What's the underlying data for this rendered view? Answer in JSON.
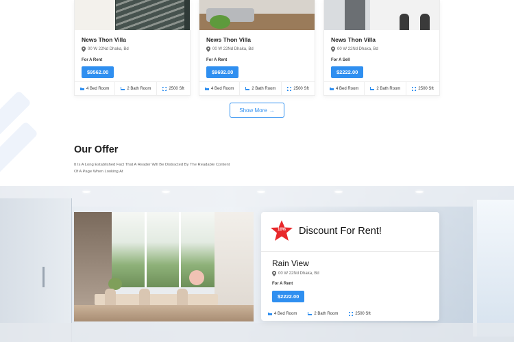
{
  "colors": {
    "accent": "#2f8ff0",
    "badge_red": "#e8282b"
  },
  "listings": [
    {
      "title": "News Thon Villa",
      "address": "00 W 22Nd Dhaka, Bd",
      "tag": "For A Rent",
      "price": "$9562.00",
      "features": [
        "4 Bed Room",
        "2 Bath Room",
        "2500 Sft"
      ]
    },
    {
      "title": "News Thon Villa",
      "address": "00 W 22Nd Dhaka, Bd",
      "tag": "For A Rent",
      "price": "$9692.00",
      "features": [
        "4 Bed Room",
        "2 Bath Room",
        "2500 Sft"
      ]
    },
    {
      "title": "News Thon Villa",
      "address": "00 W 22Nd Dhaka, Bd",
      "tag": "For A Sell",
      "price": "$2222.00",
      "features": [
        "4 Bed Room",
        "2 Bath Room",
        "2500 Sft"
      ]
    }
  ],
  "show_more": {
    "label": "Show More",
    "icon": "arrow-right-icon"
  },
  "offer": {
    "heading": "Our Offer",
    "description": "It Is A Long Established Fact That A Reader Will Be Distracted By The Readable Content Of A Page When Looking At",
    "badge_text": "10%",
    "discount_title": "Discount For Rent!",
    "property": {
      "name": "Rain View",
      "address": "00 W 22Nd Dhaka, Bd",
      "tag": "For A Rent",
      "price": "$2222.00",
      "features": [
        "4 Bed Room",
        "2 Bath Room",
        "2500 Sft"
      ]
    }
  }
}
